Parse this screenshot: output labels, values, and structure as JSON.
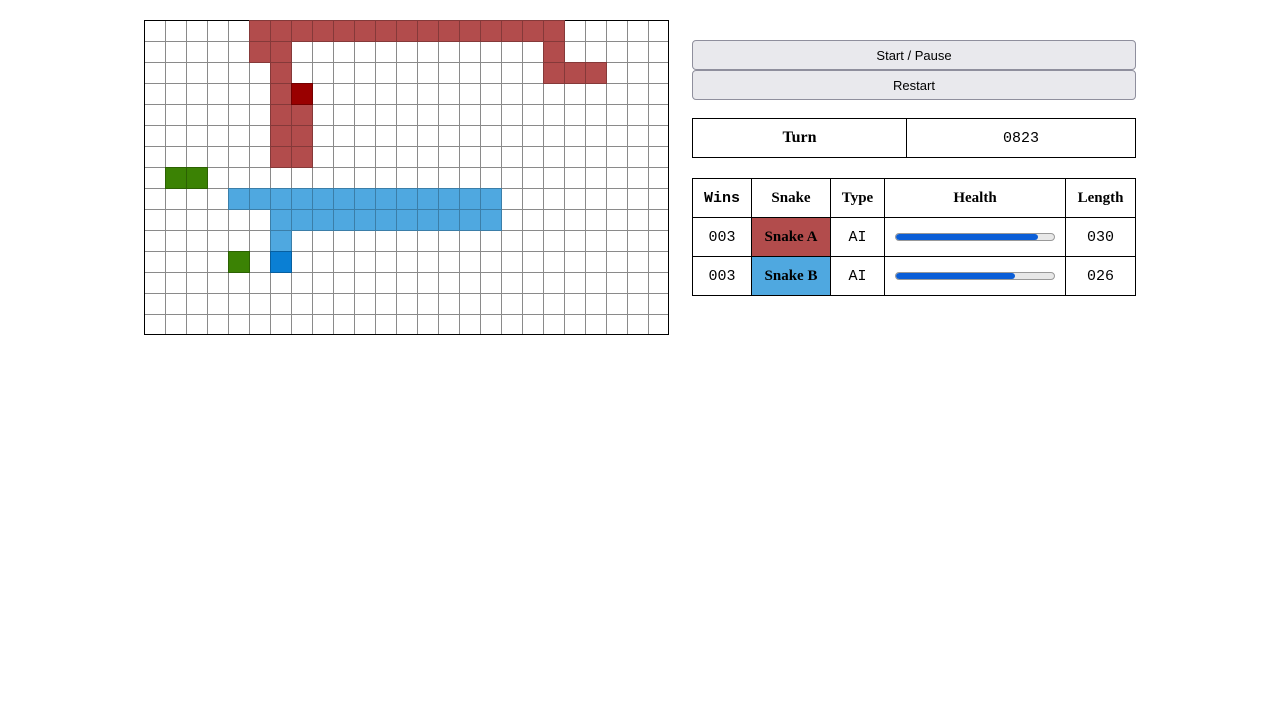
{
  "controls": {
    "start_pause_label": "Start / Pause",
    "restart_label": "Restart"
  },
  "turn": {
    "label": "Turn",
    "value": "0823"
  },
  "stats": {
    "headers": [
      "Wins",
      "Snake",
      "Type",
      "Health",
      "Length"
    ],
    "rows": [
      {
        "wins": "003",
        "name": "Snake A",
        "type": "AI",
        "health": 0.9,
        "length": "030",
        "color": "#b24c4c"
      },
      {
        "wins": "003",
        "name": "Snake B",
        "type": "AI",
        "health": 0.75,
        "length": "026",
        "color": "#4fa8e0"
      }
    ]
  },
  "board": {
    "columns": 25,
    "rows": 15,
    "food_color": "#3b8204",
    "food": [
      [
        1,
        7
      ],
      [
        2,
        7
      ],
      [
        4,
        11
      ]
    ],
    "snakes": [
      {
        "name": "Snake A",
        "body_color": "#b24c4c",
        "head_color": "#990000",
        "head": [
          7,
          3
        ],
        "body": [
          [
            5,
            0
          ],
          [
            6,
            0
          ],
          [
            7,
            0
          ],
          [
            8,
            0
          ],
          [
            9,
            0
          ],
          [
            10,
            0
          ],
          [
            11,
            0
          ],
          [
            12,
            0
          ],
          [
            13,
            0
          ],
          [
            14,
            0
          ],
          [
            15,
            0
          ],
          [
            16,
            0
          ],
          [
            17,
            0
          ],
          [
            18,
            0
          ],
          [
            19,
            0
          ],
          [
            5,
            1
          ],
          [
            6,
            1
          ],
          [
            19,
            1
          ],
          [
            6,
            2
          ],
          [
            19,
            2
          ],
          [
            20,
            2
          ],
          [
            21,
            2
          ],
          [
            6,
            3
          ],
          [
            6,
            4
          ],
          [
            7,
            4
          ],
          [
            6,
            5
          ],
          [
            7,
            5
          ],
          [
            6,
            6
          ],
          [
            7,
            6
          ]
        ]
      },
      {
        "name": "Snake B",
        "body_color": "#4fa8e0",
        "head_color": "#0a7fd4",
        "head": [
          6,
          11
        ],
        "body": [
          [
            4,
            8
          ],
          [
            5,
            8
          ],
          [
            6,
            8
          ],
          [
            7,
            8
          ],
          [
            8,
            8
          ],
          [
            9,
            8
          ],
          [
            10,
            8
          ],
          [
            11,
            8
          ],
          [
            12,
            8
          ],
          [
            13,
            8
          ],
          [
            14,
            8
          ],
          [
            15,
            8
          ],
          [
            16,
            8
          ],
          [
            6,
            9
          ],
          [
            7,
            9
          ],
          [
            8,
            9
          ],
          [
            9,
            9
          ],
          [
            10,
            9
          ],
          [
            11,
            9
          ],
          [
            12,
            9
          ],
          [
            13,
            9
          ],
          [
            14,
            9
          ],
          [
            15,
            9
          ],
          [
            16,
            9
          ],
          [
            6,
            10
          ]
        ]
      }
    ]
  }
}
